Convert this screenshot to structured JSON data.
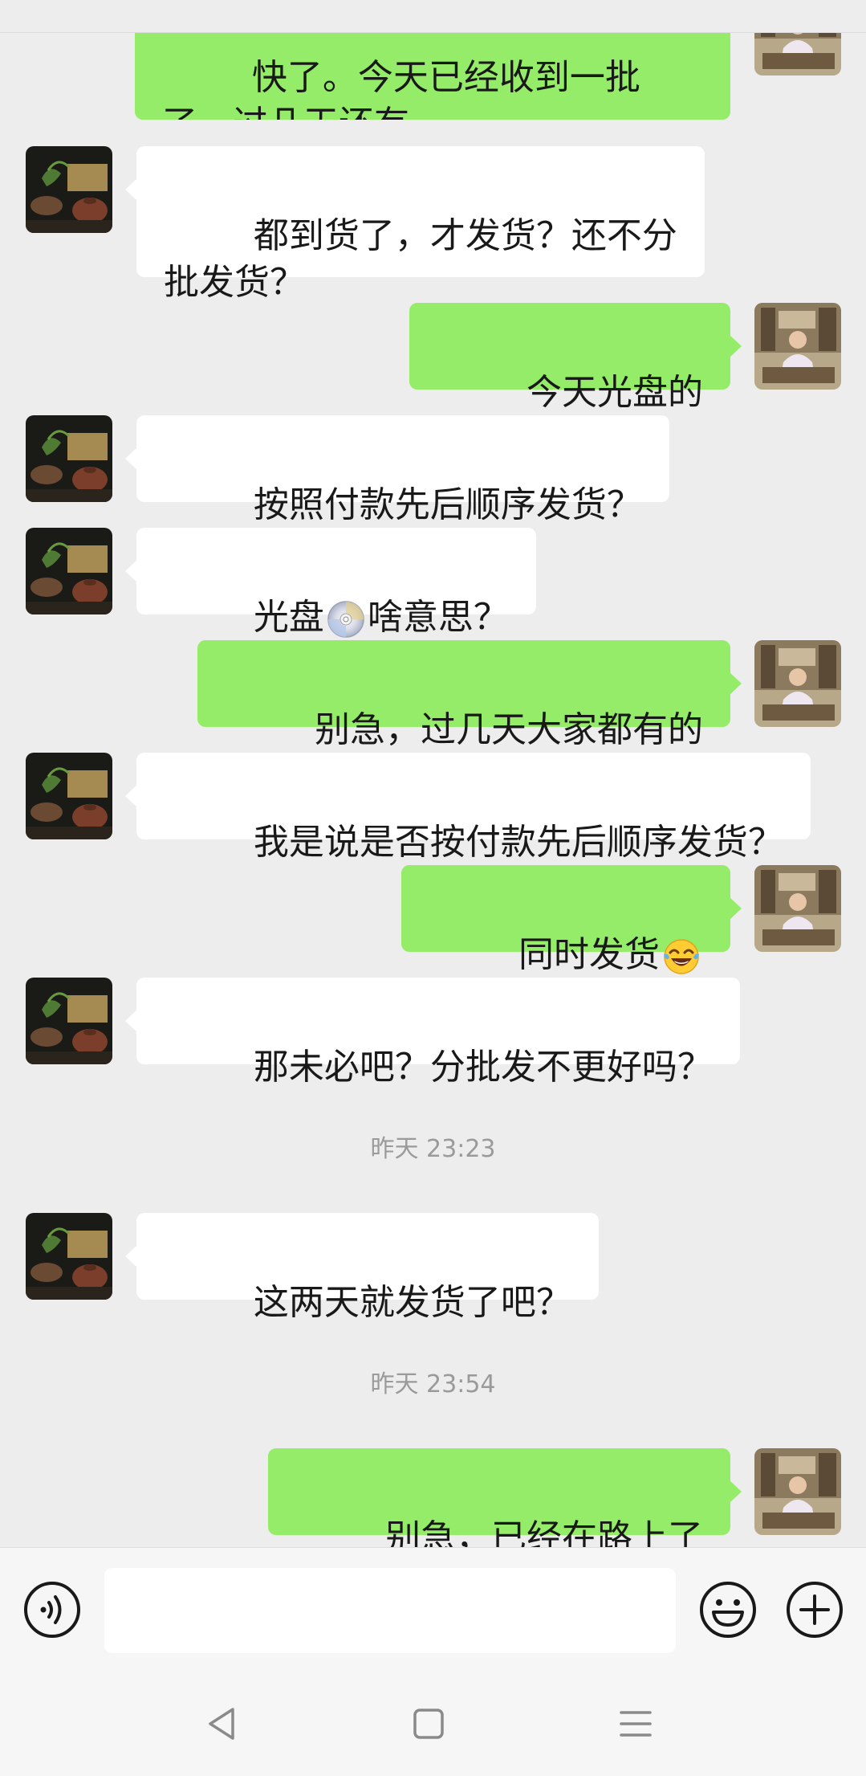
{
  "messages": [
    {
      "side": "out",
      "text": "快了。今天已经收到一批了，过几天还有"
    },
    {
      "side": "in",
      "text": "都到货了，才发货？还不分批发货？"
    },
    {
      "side": "out",
      "text": "今天光盘的"
    },
    {
      "side": "in",
      "text": "按照付款先后顺序发货？"
    },
    {
      "side": "in",
      "text_before": "光盘",
      "emoji": "cd-emoji",
      "text_after": "啥意思？"
    },
    {
      "side": "out",
      "text": "别急，过几天大家都有的"
    },
    {
      "side": "in",
      "text": "我是说是否按付款先后顺序发货？"
    },
    {
      "side": "out",
      "text": "同时发货",
      "emoji": "crying-laughing-emoji"
    },
    {
      "side": "in",
      "text": "那未必吧？分批发不更好吗？"
    },
    {
      "side": "in",
      "text": "这两天就发货了吧？"
    },
    {
      "side": "out",
      "text": "别急，已经在路上了"
    }
  ],
  "timestamps": [
    "昨天 23:23",
    "昨天 23:54"
  ],
  "input": {
    "value": "",
    "placeholder": ""
  },
  "icons": {
    "voice": "voice-icon",
    "emoji": "emoji-smiley-icon",
    "plus": "plus-icon",
    "back": "back-nav-icon",
    "home": "home-nav-icon",
    "menu": "menu-nav-icon"
  },
  "colors": {
    "background": "#ededed",
    "outgoing_bubble": "#95ec69",
    "incoming_bubble": "#ffffff",
    "timestamp_text": "#9a9a9a"
  }
}
